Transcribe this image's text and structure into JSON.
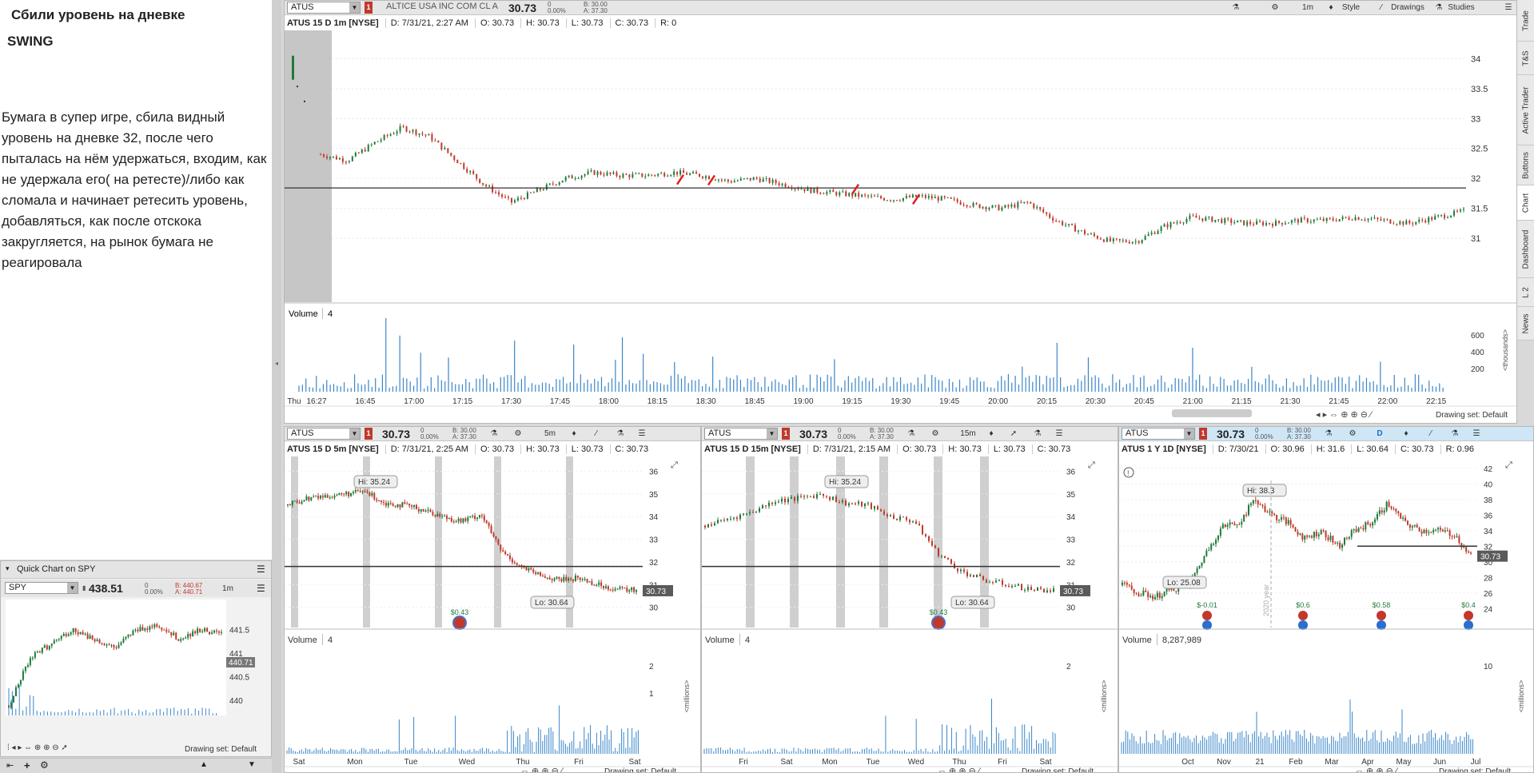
{
  "notes": {
    "title": "Сбили уровень на дневке",
    "subtitle": "SWING",
    "body": "Бумага в супер игре, сбила видный уровень на дневке 32, после чего пыталась на нём удержаться, входим, как не удержала его( на ретесте)/либо как сломала и начинает ретесить уровень, добавляться, как после отскока закругляется, на рынок бумага не реагировала"
  },
  "main": {
    "symbol": "ATUS",
    "badge": "1",
    "company": "ALTICE USA INC COM CL A",
    "price": "30.73",
    "change": "0",
    "change_pct": "0.00%",
    "bid": "B: 30.00",
    "ask": "A: 37.30",
    "toolbar": {
      "flask": "⚗",
      "gear": "⚙",
      "tf": "1m",
      "style": "Style",
      "drawings": "Drawings",
      "studies": "Studies"
    },
    "info": {
      "title": "ATUS 15 D 1m [NYSE]",
      "d": "D: 7/31/21, 2:27 AM",
      "o": "O: 30.73",
      "h": "H: 30.73",
      "l": "L: 30.73",
      "c": "C: 30.73",
      "r": "R: 0"
    },
    "volume_label": "Volume",
    "volume_val": "4",
    "drawing_set": "Drawing set: Default"
  },
  "chart_data": [
    {
      "id": "main-1m",
      "type": "candlestick",
      "y_ticks": [
        "34",
        "33.5",
        "33",
        "32.5",
        "32",
        "31.5",
        "31"
      ],
      "ylim": [
        30.8,
        34.3
      ],
      "x_ticks": [
        "Thu",
        "16:27",
        "16:45",
        "17:00",
        "17:15",
        "17:30",
        "17:45",
        "18:00",
        "18:15",
        "18:30",
        "18:45",
        "19:00",
        "19:15",
        "19:30",
        "19:45",
        "20:00",
        "20:15",
        "20:30",
        "20:45",
        "21:00",
        "21:15",
        "21:30",
        "21:45",
        "22:00",
        "22:15"
      ],
      "close_path": [
        [
          0,
          32.4
        ],
        [
          1,
          32.3
        ],
        [
          2,
          32.6
        ],
        [
          3,
          32.85
        ],
        [
          4,
          32.7
        ],
        [
          5,
          32.3
        ],
        [
          6,
          31.9
        ],
        [
          7,
          31.6
        ],
        [
          8,
          31.8
        ],
        [
          9,
          32.0
        ],
        [
          10,
          32.1
        ],
        [
          11,
          32.05
        ],
        [
          12,
          32.05
        ],
        [
          13,
          32.1
        ],
        [
          14,
          32.05
        ],
        [
          15,
          31.95
        ],
        [
          16,
          32.0
        ],
        [
          17,
          31.9
        ],
        [
          18,
          31.8
        ],
        [
          19,
          31.75
        ],
        [
          20,
          31.7
        ],
        [
          21,
          31.65
        ],
        [
          22,
          31.7
        ],
        [
          23,
          31.65
        ],
        [
          24,
          31.55
        ],
        [
          25,
          31.5
        ],
        [
          26,
          31.6
        ],
        [
          27,
          31.3
        ],
        [
          28,
          31.1
        ],
        [
          29,
          30.95
        ],
        [
          30,
          30.95
        ],
        [
          31,
          31.2
        ],
        [
          32,
          31.35
        ],
        [
          33,
          31.3
        ],
        [
          34,
          31.25
        ],
        [
          35,
          31.25
        ],
        [
          36,
          31.3
        ],
        [
          37,
          31.3
        ],
        [
          38,
          31.35
        ],
        [
          39,
          31.3
        ],
        [
          40,
          31.25
        ],
        [
          41,
          31.35
        ],
        [
          42,
          31.45
        ]
      ],
      "level": 31.84,
      "volume_axis": [
        "600",
        "400",
        "200"
      ],
      "volume_unit": "<thousands>"
    },
    {
      "id": "chart-5m",
      "type": "candlestick",
      "y_ticks": [
        "36",
        "35",
        "34",
        "33",
        "32",
        "31",
        "30"
      ],
      "ylim": [
        29.6,
        36.3
      ],
      "x_ticks": [
        "Sat",
        "Mon",
        "Tue",
        "Wed",
        "Thu",
        "Fri",
        "Sat"
      ],
      "close_path": [
        [
          0,
          34.5
        ],
        [
          1,
          34.8
        ],
        [
          2,
          34.9
        ],
        [
          3,
          35.0
        ],
        [
          4,
          35.1
        ],
        [
          5,
          34.6
        ],
        [
          6,
          34.5
        ],
        [
          7,
          34.3
        ],
        [
          8,
          34.0
        ],
        [
          9,
          33.8
        ],
        [
          10,
          34.1
        ],
        [
          11,
          32.5
        ],
        [
          12,
          31.8
        ],
        [
          13,
          31.4
        ],
        [
          14,
          31.2
        ],
        [
          15,
          31.3
        ],
        [
          16,
          31.0
        ],
        [
          17,
          30.8
        ],
        [
          18,
          30.75
        ]
      ],
      "level": 31.8,
      "hi_label": "Hi: 35.24",
      "lo_label": "Lo: 30.64",
      "last": "30.73",
      "dividend": "$0.43",
      "volume_axis": [
        "2",
        "1"
      ],
      "volume_unit": "<millions>"
    },
    {
      "id": "chart-15m",
      "type": "candlestick",
      "y_ticks": [
        "36",
        "35",
        "34",
        "33",
        "32",
        "31",
        "30"
      ],
      "ylim": [
        29.6,
        36.3
      ],
      "x_ticks": [
        "Fri",
        "Sat",
        "Mon",
        "Tue",
        "Wed",
        "Thu",
        "Fri",
        "Sat"
      ],
      "close_path": [
        [
          0,
          33.6
        ],
        [
          1,
          33.9
        ],
        [
          2,
          34.2
        ],
        [
          3,
          34.7
        ],
        [
          4,
          34.8
        ],
        [
          5,
          35.0
        ],
        [
          6,
          34.6
        ],
        [
          7,
          34.5
        ],
        [
          8,
          34.0
        ],
        [
          9,
          33.8
        ],
        [
          10,
          32.4
        ],
        [
          11,
          31.6
        ],
        [
          12,
          31.2
        ],
        [
          13,
          31.0
        ],
        [
          14,
          30.8
        ],
        [
          15,
          30.75
        ]
      ],
      "level": 31.8,
      "hi_label": "Hi: 35.24",
      "lo_label": "Lo: 30.64",
      "last": "30.73",
      "dividend": "$0.43",
      "volume_axis": [
        "2"
      ],
      "volume_unit": "<millions>"
    },
    {
      "id": "chart-1y",
      "type": "candlestick",
      "y_ticks": [
        "42",
        "40",
        "38",
        "36",
        "34",
        "32",
        "30",
        "28",
        "26",
        "24"
      ],
      "ylim": [
        23,
        42.5
      ],
      "x_ticks": [
        "Oct",
        "Nov",
        "21",
        "Feb",
        "Mar",
        "Apr",
        "May",
        "Jun",
        "Jul"
      ],
      "close_path": [
        [
          0,
          27
        ],
        [
          1,
          26
        ],
        [
          2,
          25.5
        ],
        [
          3,
          26.5
        ],
        [
          4,
          27
        ],
        [
          5,
          31
        ],
        [
          6,
          34.5
        ],
        [
          7,
          35
        ],
        [
          8,
          38
        ],
        [
          9,
          36
        ],
        [
          10,
          35
        ],
        [
          11,
          33
        ],
        [
          12,
          34
        ],
        [
          13,
          32
        ],
        [
          14,
          34
        ],
        [
          15,
          35
        ],
        [
          16,
          37.5
        ],
        [
          17,
          35
        ],
        [
          18,
          34
        ],
        [
          19,
          34
        ],
        [
          20,
          33.5
        ],
        [
          21,
          30.73
        ]
      ],
      "level": 32,
      "hi_label": "Hi: 38.3",
      "lo_label": "Lo: 25.08",
      "last": "30.73",
      "year_label": "2020 year",
      "dividends": [
        "$-0.01",
        "$0.6",
        "$0.58",
        "$0.4"
      ],
      "volume_axis": [
        "10"
      ],
      "volume_unit": "<millions>"
    },
    {
      "id": "quick-spy",
      "type": "candlestick",
      "y_ticks": [
        "441.5",
        "441",
        "440.5",
        "440"
      ],
      "ylim": [
        439.8,
        442
      ]
    }
  ],
  "p5": {
    "symbol": "ATUS",
    "badge": "1",
    "price": "30.73",
    "change": "0",
    "change_pct": "0.00%",
    "bid": "B: 30.00",
    "ask": "A: 37.30",
    "tf": "5m",
    "info": {
      "title": "ATUS 15 D 5m [NYSE]",
      "d": "D: 7/31/21, 2:25 AM",
      "o": "O: 30.73",
      "h": "H: 30.73",
      "l": "L: 30.73",
      "c": "C: 30.73"
    },
    "volume_label": "Volume",
    "volume_val": "4",
    "drawing_set": "Drawing set: Default"
  },
  "p15": {
    "symbol": "ATUS",
    "badge": "1",
    "price": "30.73",
    "change": "0",
    "change_pct": "0.00%",
    "bid": "B: 30.00",
    "ask": "A: 37.30",
    "tf": "15m",
    "info": {
      "title": "ATUS 15 D 15m [NYSE]",
      "d": "D: 7/31/21, 2:15 AM",
      "o": "O: 30.73",
      "h": "H: 30.73",
      "l": "L: 30.73",
      "c": "C: 30.73"
    },
    "volume_label": "Volume",
    "volume_val": "4",
    "drawing_set": "Drawing set: Default"
  },
  "p1y": {
    "symbol": "ATUS",
    "badge": "1",
    "price": "30.73",
    "change": "0",
    "change_pct": "0.00%",
    "bid": "B: 30.00",
    "ask": "A: 37.30",
    "tf": "D",
    "info": {
      "title": "ATUS 1 Y 1D [NYSE]",
      "d": "D: 7/30/21",
      "o": "O: 30.96",
      "h": "H: 31.6",
      "l": "L: 30.64",
      "c": "C: 30.73",
      "r": "R: 0.96"
    },
    "volume_label": "Volume",
    "volume_val": "8,287,989",
    "drawing_set": "Drawing set: Default"
  },
  "quick": {
    "title": "Quick Chart on SPY",
    "symbol": "SPY",
    "price": "438.51",
    "change": "0",
    "change_pct": "0.00%",
    "bid": "B: 440.67",
    "ask": "A: 440.71",
    "tf": "1m",
    "last": "440.71",
    "drawing_set": "Drawing set: Default"
  },
  "sidetabs": [
    "Trade",
    "T&S",
    "Active Trader",
    "Buttons",
    "Chart",
    "Dashboard",
    "L 2",
    "News"
  ],
  "colors": {
    "up": "#1f7a3a",
    "down": "#c0392b",
    "volume": "#3a86c8",
    "level": "#333333",
    "marker": "#e02020",
    "accent": "#2a8fd6"
  }
}
